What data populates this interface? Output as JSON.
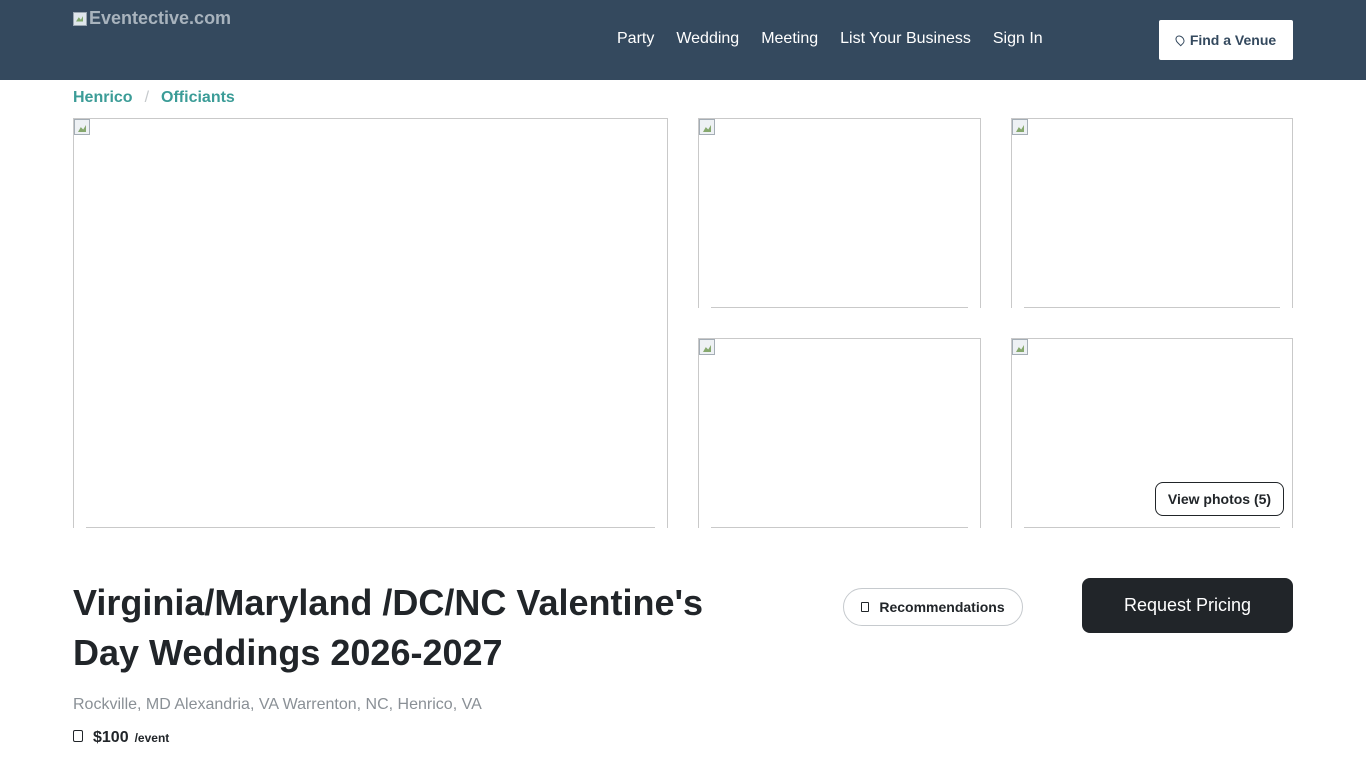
{
  "header": {
    "logo_alt": "Eventective.com",
    "nav": [
      {
        "label": "Party"
      },
      {
        "label": "Wedding"
      },
      {
        "label": "Meeting"
      },
      {
        "label": "List Your Business"
      },
      {
        "label": "Sign In"
      }
    ],
    "find_venue_label": "Find a Venue",
    "find_venue_icon": "map-marker-icon",
    "background_color": "#34495e"
  },
  "breadcrumb": {
    "items": [
      "Henrico",
      "Officiants"
    ],
    "separator": "/",
    "link_color": "#3b9c97"
  },
  "gallery": {
    "view_photos_label": "View photos (5)"
  },
  "listing": {
    "title": "Virginia/Maryland /DC/NC Valentine's Day Weddings 2026-2027",
    "location": "Rockville, MD Alexandria, VA Warrenton, NC, Henrico, VA",
    "price_icon": "price-tag-icon",
    "price": "$100",
    "price_unit": "/event"
  },
  "actions": {
    "recommendations_label": "Recommendations",
    "recommendations_icon": "bookmark-icon",
    "request_pricing_label": "Request Pricing"
  }
}
